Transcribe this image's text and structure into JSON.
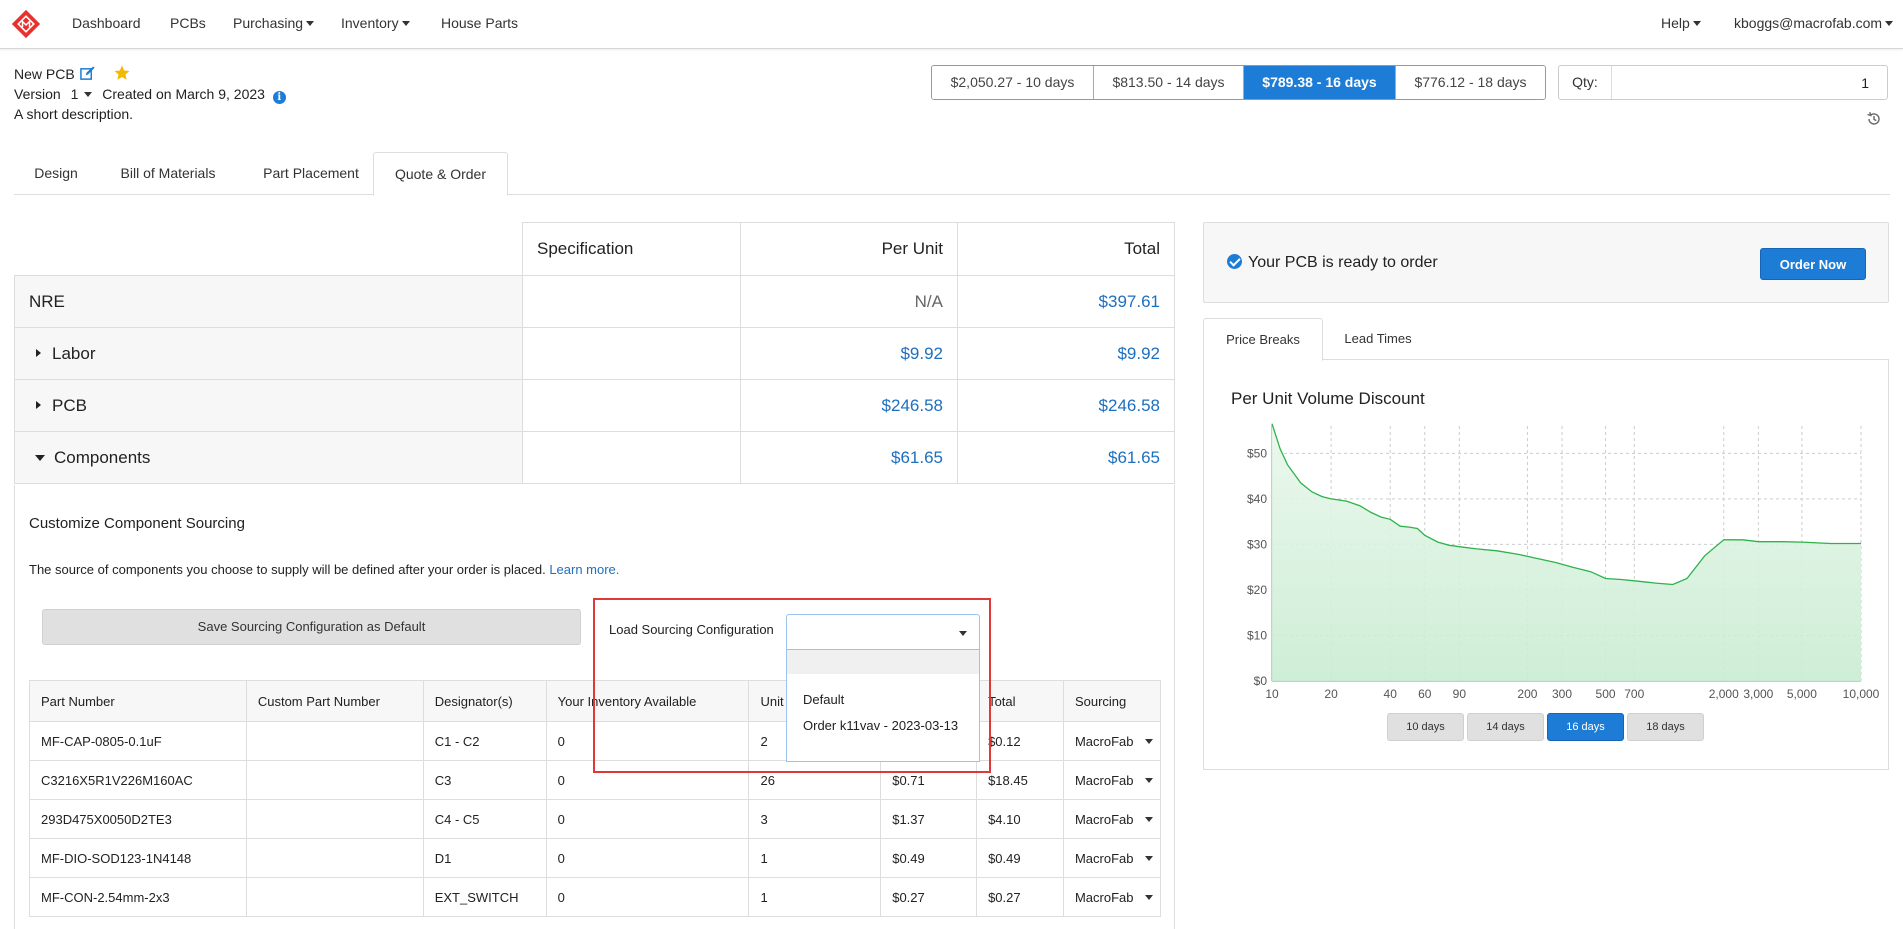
{
  "nav": {
    "items": [
      "Dashboard",
      "PCBs",
      "Purchasing",
      "Inventory",
      "House Parts"
    ],
    "help": "Help",
    "user": "kboggs@macrofab.com"
  },
  "pcb": {
    "name": "New PCB",
    "version_label": "Version",
    "version": "1",
    "created": "Created on March 9, 2023",
    "description": "A short description."
  },
  "price_options": [
    {
      "label": "$2,050.27 - 10 days",
      "active": false
    },
    {
      "label": "$813.50 - 14 days",
      "active": false
    },
    {
      "label": "$789.38 - 16 days",
      "active": true
    },
    {
      "label": "$776.12 - 18 days",
      "active": false
    }
  ],
  "qty": {
    "label": "Qty:",
    "value": "1"
  },
  "tabs": [
    "Design",
    "Bill of Materials",
    "Part Placement",
    "Quote & Order"
  ],
  "active_tab": "Quote & Order",
  "cost_table": {
    "headers": [
      "Specification",
      "Per Unit",
      "Total"
    ],
    "rows": [
      {
        "label": "NRE",
        "per_unit": "N/A",
        "total": "$397.61",
        "expand": "none"
      },
      {
        "label": "Labor",
        "per_unit": "$9.92",
        "total": "$9.92",
        "expand": "collapsed"
      },
      {
        "label": "PCB",
        "per_unit": "$246.58",
        "total": "$246.58",
        "expand": "collapsed"
      },
      {
        "label": "Components",
        "per_unit": "$61.65",
        "total": "$61.65",
        "expand": "expanded"
      }
    ]
  },
  "sourcing": {
    "title": "Customize Component Sourcing",
    "note": "The source of components you choose to supply will be defined after your order is placed.",
    "learn_more": "Learn more.",
    "save_button": "Save Sourcing Configuration as Default",
    "load_label": "Load Sourcing Configuration",
    "options": [
      "Default",
      "Order k11vav - 2023-03-13"
    ]
  },
  "parts_table": {
    "headers": [
      "Part Number",
      "Custom Part Number",
      "Designator(s)",
      "Your Inventory Available",
      "Unit",
      "",
      "Total",
      "Sourcing"
    ],
    "rows": [
      [
        "MF-CAP-0805-0.1uF",
        "",
        "C1 - C2",
        "0",
        "2",
        "",
        "$0.12",
        "MacroFab"
      ],
      [
        "C3216X5R1V226M160AC",
        "",
        "C3",
        "0",
        "26",
        "$0.71",
        "$18.45",
        "MacroFab"
      ],
      [
        "293D475X0050D2TE3",
        "",
        "C4 - C5",
        "0",
        "3",
        "$1.37",
        "$4.10",
        "MacroFab"
      ],
      [
        "MF-DIO-SOD123-1N4148",
        "",
        "D1",
        "0",
        "1",
        "$0.49",
        "$0.49",
        "MacroFab"
      ],
      [
        "MF-CON-2.54mm-2x3",
        "",
        "EXT_SWITCH",
        "0",
        "1",
        "$0.27",
        "$0.27",
        "MacroFab"
      ]
    ]
  },
  "ready": {
    "text": "Your PCB is ready to order",
    "button": "Order Now"
  },
  "chart_tabs": [
    "Price Breaks",
    "Lead Times"
  ],
  "chart_data": {
    "type": "area",
    "title": "Per Unit Volume Discount",
    "x_scale": "log",
    "x_ticks": [
      "10",
      "20",
      "40",
      "60",
      "90",
      "200",
      "300",
      "500",
      "700",
      "2,000",
      "3,000",
      "5,000",
      "10,000"
    ],
    "y_ticks": [
      "$0",
      "$10",
      "$20",
      "$30",
      "$40",
      "$50"
    ],
    "ylim": [
      0,
      56
    ],
    "grid": true,
    "color": "#2db34a",
    "x": [
      10,
      11,
      12,
      14,
      16,
      18,
      20,
      24,
      28,
      32,
      36,
      40,
      45,
      50,
      55,
      60,
      70,
      80,
      90,
      110,
      140,
      180,
      220,
      280,
      340,
      420,
      500,
      600,
      700,
      900,
      1100,
      1300,
      1600,
      2000,
      2500,
      3000,
      4000,
      5000,
      7000,
      10000
    ],
    "values": [
      56.5,
      51,
      47.5,
      43.5,
      41.5,
      40.5,
      40,
      39.5,
      38.5,
      37,
      36,
      35.5,
      34,
      33.8,
      33.5,
      32,
      30.5,
      29.8,
      29.5,
      29,
      28.6,
      27.8,
      27,
      26,
      25,
      24,
      22.5,
      22.3,
      22,
      21.5,
      21.2,
      22.5,
      27.5,
      31,
      31,
      30.6,
      30.6,
      30.5,
      30.2,
      30.2
    ],
    "day_options": [
      "10 days",
      "14 days",
      "16 days",
      "18 days"
    ],
    "active_day": "16 days"
  }
}
